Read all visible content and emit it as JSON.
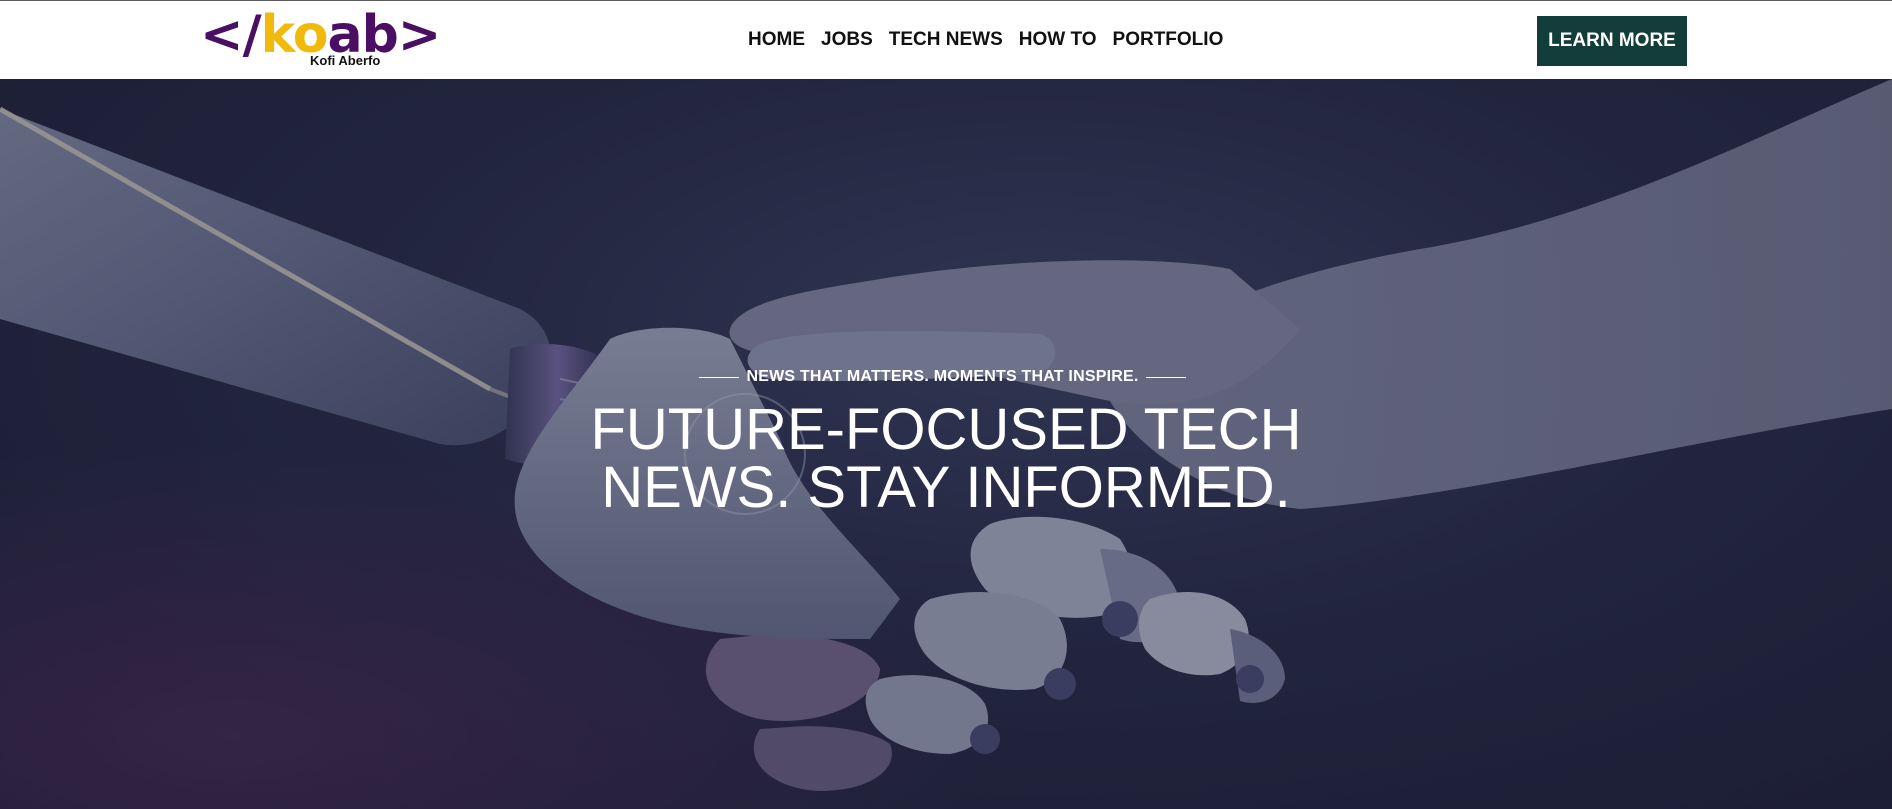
{
  "brand": {
    "logo_open": "</",
    "logo_letters_gold": "ko",
    "logo_letters_purple": "ab",
    "logo_close": ">",
    "tagline": "Kofi Aberfo",
    "colors": {
      "purple": "#4a0e63",
      "gold": "#f0b90b"
    }
  },
  "nav": {
    "items": [
      {
        "label": "HOME"
      },
      {
        "label": "JOBS"
      },
      {
        "label": "TECH NEWS"
      },
      {
        "label": "HOW TO"
      },
      {
        "label": "PORTFOLIO"
      }
    ]
  },
  "header": {
    "cta_label": "LEARN MORE",
    "cta_color": "#123d3a"
  },
  "hero": {
    "eyebrow": "NEWS THAT MATTERS. MOMENTS THAT INSPIRE.",
    "headline_line1": "FUTURE-FOCUSED TECH",
    "headline_line2": "NEWS. STAY INFORMED.",
    "image": "robot-human-handshake-image"
  }
}
